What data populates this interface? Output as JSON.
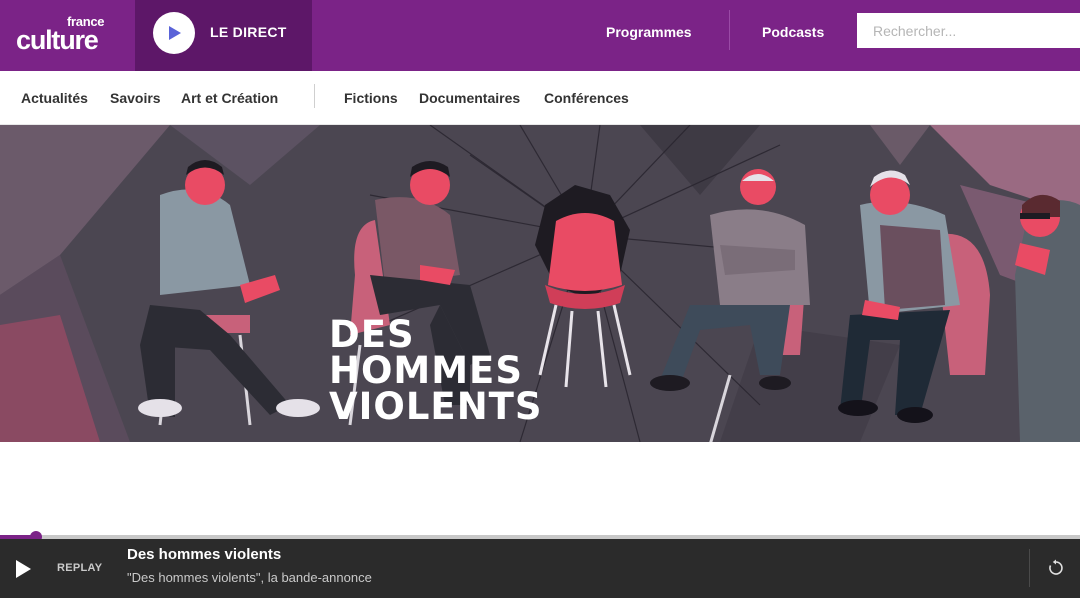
{
  "header": {
    "logo_small": "france",
    "logo_big": "culture",
    "live_label": "LE DIRECT",
    "nav": [
      "Programmes",
      "Podcasts"
    ],
    "search_placeholder": "Rechercher..."
  },
  "subnav": {
    "left": [
      "Actualités",
      "Savoirs",
      "Art et Création"
    ],
    "right": [
      "Fictions",
      "Documentaires",
      "Conférences"
    ]
  },
  "hero": {
    "title_lines": [
      "DES",
      "HOMMES",
      "VIOLENTS"
    ]
  },
  "player": {
    "mode_label": "REPLAY",
    "title": "Des hommes violents",
    "subtitle": "\"Des hommes violents\", la bande-annonce",
    "progress_percent": 3.3
  },
  "colors": {
    "brand_purple": "#7b2387",
    "brand_purple_dark": "#5d1768",
    "accent_pink": "#e94b64",
    "player_bg": "#2b2b2b"
  },
  "icons": {
    "live_play": "play-icon",
    "player_play": "play-icon",
    "restart": "restart-icon"
  }
}
